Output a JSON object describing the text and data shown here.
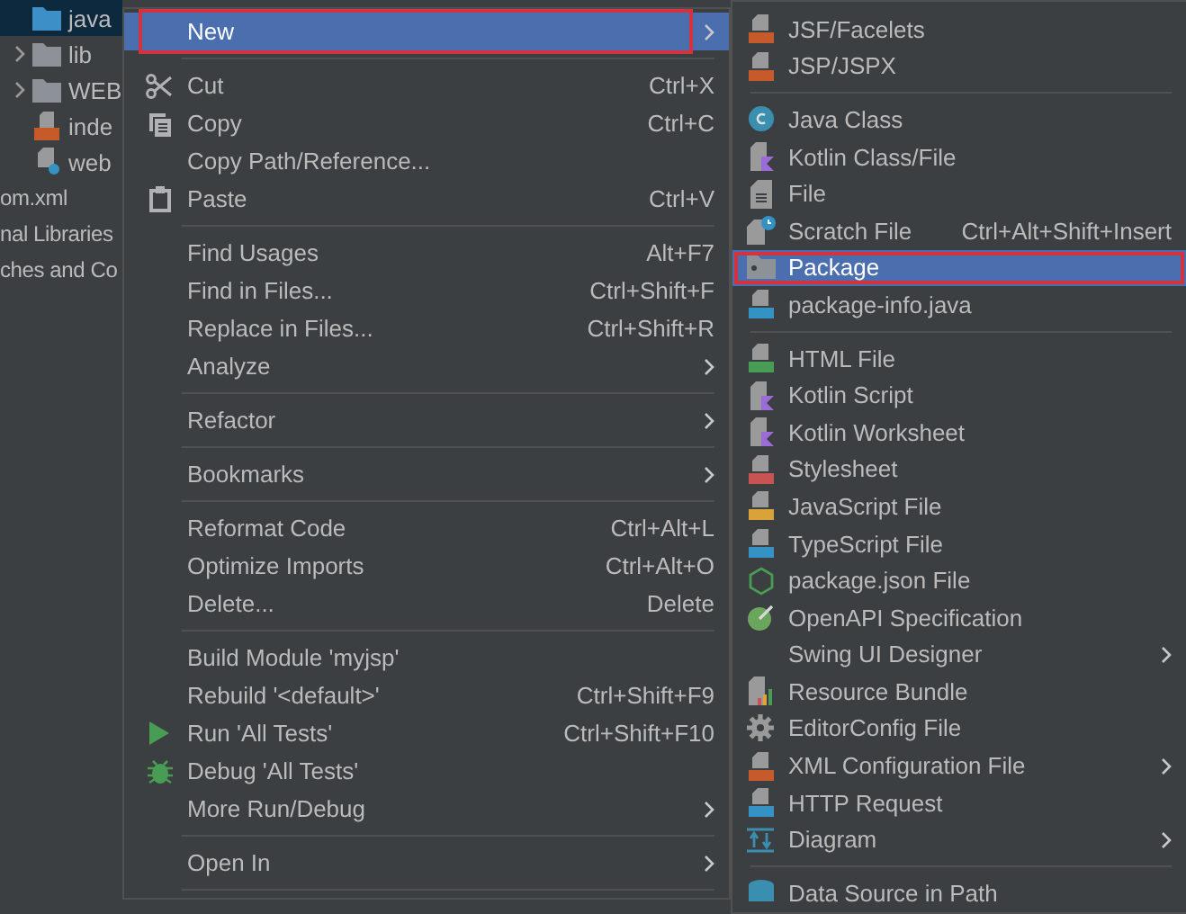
{
  "project_tree": [
    {
      "children": [
        {
          "label": "java",
          "kind": "folder",
          "collapsed": false,
          "selected": true
        },
        {
          "label": "lib",
          "kind": "folder",
          "collapsed": true,
          "selected": false
        },
        {
          "label": "WEB",
          "kind": "folder",
          "collapsed": true,
          "selected": false
        },
        {
          "label": "inde",
          "kind": "jsp",
          "collapsed": false,
          "selected": false
        },
        {
          "label": "web",
          "kind": "config",
          "collapsed": false,
          "selected": false
        }
      ]
    },
    {
      "label": "om.xml",
      "collapsed": false,
      "selected": false
    },
    {
      "label": "nal Libraries",
      "collapsed": false,
      "selected": false
    },
    {
      "label": "ches and Co",
      "collapsed": false,
      "selected": false
    }
  ],
  "context_menu": {
    "items": [
      {
        "kind": "item",
        "label": "New",
        "submenu": true,
        "selected": true
      },
      {
        "kind": "separator"
      },
      {
        "kind": "item",
        "label": "Cut",
        "shortcut": "Ctrl+X",
        "submenu": false,
        "selected": false
      },
      {
        "kind": "item",
        "label": "Copy",
        "shortcut": "Ctrl+C",
        "submenu": false,
        "selected": false
      },
      {
        "kind": "item",
        "label": "Copy Path/Reference...",
        "submenu": false,
        "selected": false
      },
      {
        "kind": "item",
        "label": "Paste",
        "shortcut": "Ctrl+V",
        "submenu": false,
        "selected": false
      },
      {
        "kind": "separator"
      },
      {
        "kind": "item",
        "label": "Find Usages",
        "shortcut": "Alt+F7",
        "submenu": false,
        "selected": false
      },
      {
        "kind": "item",
        "label": "Find in Files...",
        "shortcut": "Ctrl+Shift+F",
        "submenu": false,
        "selected": false
      },
      {
        "kind": "item",
        "label": "Replace in Files...",
        "shortcut": "Ctrl+Shift+R",
        "submenu": false,
        "selected": false
      },
      {
        "kind": "item",
        "label": "Analyze",
        "submenu": true,
        "selected": false
      },
      {
        "kind": "separator"
      },
      {
        "kind": "item",
        "label": "Refactor",
        "submenu": true,
        "selected": false
      },
      {
        "kind": "separator"
      },
      {
        "kind": "item",
        "label": "Bookmarks",
        "submenu": true,
        "selected": false
      },
      {
        "kind": "separator"
      },
      {
        "kind": "item",
        "label": "Reformat Code",
        "shortcut": "Ctrl+Alt+L",
        "submenu": false,
        "selected": false
      },
      {
        "kind": "item",
        "label": "Optimize Imports",
        "shortcut": "Ctrl+Alt+O",
        "submenu": false,
        "selected": false
      },
      {
        "kind": "item",
        "label": "Delete...",
        "shortcut": "Delete",
        "submenu": false,
        "selected": false
      },
      {
        "kind": "separator"
      },
      {
        "kind": "item",
        "label": "Build Module 'myjsp'",
        "submenu": false,
        "selected": false
      },
      {
        "kind": "item",
        "label": "Rebuild '<default>'",
        "shortcut": "Ctrl+Shift+F9",
        "submenu": false,
        "selected": false
      },
      {
        "kind": "item",
        "label": "Run 'All Tests'",
        "shortcut": "Ctrl+Shift+F10",
        "submenu": false,
        "selected": false
      },
      {
        "kind": "item",
        "label": "Debug 'All Tests'",
        "submenu": false,
        "selected": false
      },
      {
        "kind": "item",
        "label": "More Run/Debug",
        "submenu": true,
        "selected": false
      },
      {
        "kind": "separator"
      },
      {
        "kind": "item",
        "label": "Open In",
        "submenu": true,
        "selected": false
      },
      {
        "kind": "separator"
      }
    ]
  },
  "new_submenu": {
    "items": [
      {
        "kind": "item",
        "label": "JSF/Facelets",
        "submenu": false,
        "selected": false
      },
      {
        "kind": "item",
        "label": "JSP/JSPX",
        "submenu": false,
        "selected": false
      },
      {
        "kind": "separator"
      },
      {
        "kind": "item",
        "label": "Java Class",
        "submenu": false,
        "selected": false
      },
      {
        "kind": "item",
        "label": "Kotlin Class/File",
        "submenu": false,
        "selected": false
      },
      {
        "kind": "item",
        "label": "File",
        "submenu": false,
        "selected": false
      },
      {
        "kind": "item",
        "label": "Scratch File",
        "shortcut": "Ctrl+Alt+Shift+Insert",
        "submenu": false,
        "selected": false
      },
      {
        "kind": "item",
        "label": "Package",
        "submenu": false,
        "selected": true
      },
      {
        "kind": "item",
        "label": "package-info.java",
        "submenu": false,
        "selected": false
      },
      {
        "kind": "separator"
      },
      {
        "kind": "item",
        "label": "HTML File",
        "submenu": false,
        "selected": false
      },
      {
        "kind": "item",
        "label": "Kotlin Script",
        "submenu": false,
        "selected": false
      },
      {
        "kind": "item",
        "label": "Kotlin Worksheet",
        "submenu": false,
        "selected": false
      },
      {
        "kind": "item",
        "label": "Stylesheet",
        "submenu": false,
        "selected": false
      },
      {
        "kind": "item",
        "label": "JavaScript File",
        "submenu": false,
        "selected": false
      },
      {
        "kind": "item",
        "label": "TypeScript File",
        "submenu": false,
        "selected": false
      },
      {
        "kind": "item",
        "label": "package.json File",
        "submenu": false,
        "selected": false
      },
      {
        "kind": "item",
        "label": "OpenAPI Specification",
        "submenu": false,
        "selected": false
      },
      {
        "kind": "item",
        "label": "Swing UI Designer",
        "submenu": true,
        "selected": false
      },
      {
        "kind": "item",
        "label": "Resource Bundle",
        "submenu": false,
        "selected": false
      },
      {
        "kind": "item",
        "label": "EditorConfig File",
        "submenu": false,
        "selected": false
      },
      {
        "kind": "item",
        "label": "XML Configuration File",
        "submenu": true,
        "selected": false
      },
      {
        "kind": "item",
        "label": "HTTP Request",
        "submenu": false,
        "selected": false
      },
      {
        "kind": "item",
        "label": "Diagram",
        "submenu": true,
        "selected": false
      },
      {
        "kind": "separator"
      },
      {
        "kind": "item",
        "label": "Data Source in Path",
        "submenu": false,
        "selected": false
      }
    ]
  }
}
